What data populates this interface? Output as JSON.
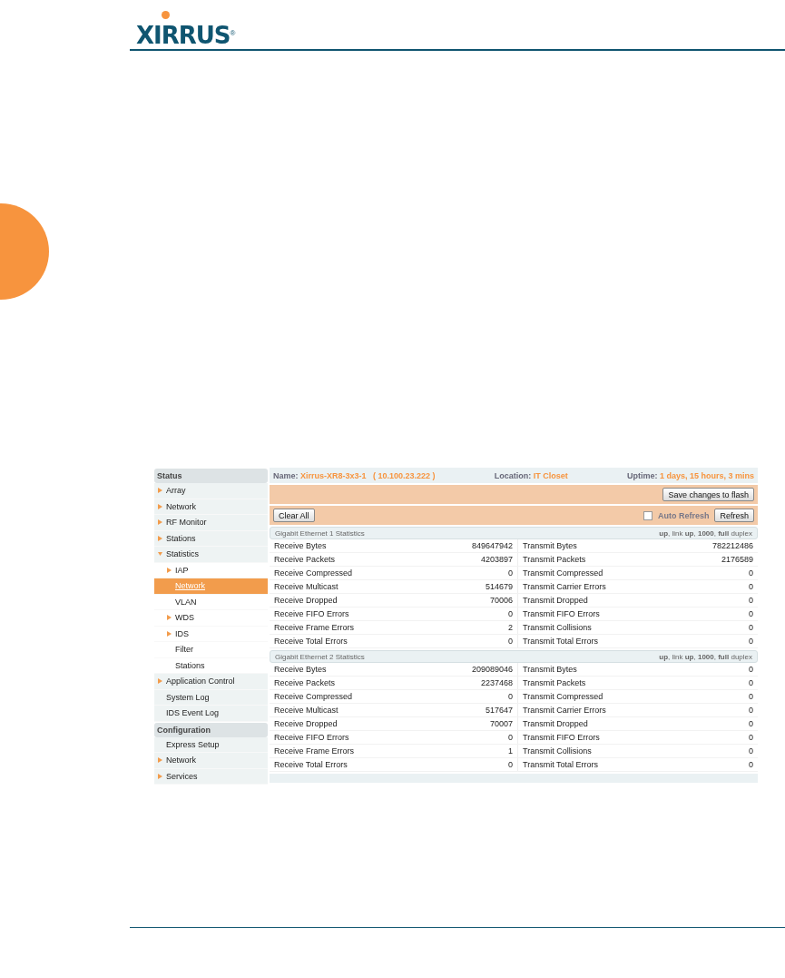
{
  "logo": {
    "text": "XIRRUS",
    "mark": "®"
  },
  "sidebar": {
    "sections": [
      {
        "title": "Status",
        "items": [
          {
            "label": "Array",
            "kind": "group",
            "expanded": false,
            "selected": false
          },
          {
            "label": "Network",
            "kind": "group",
            "expanded": false,
            "selected": false
          },
          {
            "label": "RF Monitor",
            "kind": "group",
            "expanded": false,
            "selected": false
          },
          {
            "label": "Stations",
            "kind": "group",
            "expanded": false,
            "selected": false
          },
          {
            "label": "Statistics",
            "kind": "group",
            "expanded": true,
            "selected": false,
            "children": [
              {
                "label": "IAP",
                "kind": "group",
                "expanded": false,
                "selected": false
              },
              {
                "label": "Network",
                "kind": "link",
                "expanded": false,
                "selected": true
              },
              {
                "label": "VLAN",
                "kind": "link",
                "expanded": false,
                "selected": false
              },
              {
                "label": "WDS",
                "kind": "group",
                "expanded": false,
                "selected": false
              },
              {
                "label": "IDS",
                "kind": "group",
                "expanded": false,
                "selected": false
              },
              {
                "label": "Filter",
                "kind": "link",
                "expanded": false,
                "selected": false
              },
              {
                "label": "Stations",
                "kind": "link",
                "expanded": false,
                "selected": false
              }
            ]
          },
          {
            "label": "Application Control",
            "kind": "group",
            "expanded": false,
            "selected": false
          },
          {
            "label": "System Log",
            "kind": "link",
            "expanded": false,
            "selected": false
          },
          {
            "label": "IDS Event Log",
            "kind": "link",
            "expanded": false,
            "selected": false
          }
        ]
      },
      {
        "title": "Configuration",
        "items": [
          {
            "label": "Express Setup",
            "kind": "link",
            "expanded": false,
            "selected": false
          },
          {
            "label": "Network",
            "kind": "group",
            "expanded": false,
            "selected": false
          },
          {
            "label": "Services",
            "kind": "group",
            "expanded": false,
            "selected": false
          }
        ]
      }
    ]
  },
  "header": {
    "name_label": "Name:",
    "name": "Xirrus-XR8-3x3-1   ( 10.100.23.222 )",
    "location_label": "Location:",
    "location": "IT Closet",
    "uptime_label": "Uptime:",
    "uptime": "1 days, 15 hours, 3 mins"
  },
  "save_button": "Save changes to flash",
  "toolbar": {
    "clear_button": "Clear All",
    "auto_refresh": {
      "label": "Auto Refresh",
      "checked": false
    },
    "refresh_button": "Refresh"
  },
  "interfaces": [
    {
      "title": "Gigabit Ethernet 1 Statistics",
      "status": "**up**, link **up**, **1000**, **full** duplex",
      "rows": [
        [
          "Receive Bytes",
          "849647942",
          "Transmit Bytes",
          "782212486"
        ],
        [
          "Receive Packets",
          "4203897",
          "Transmit Packets",
          "2176589"
        ],
        [
          "Receive Compressed",
          "0",
          "Transmit Compressed",
          "0"
        ],
        [
          "Receive Multicast",
          "514679",
          "Transmit Carrier Errors",
          "0"
        ],
        [
          "Receive Dropped",
          "70006",
          "Transmit Dropped",
          "0"
        ],
        [
          "Receive FIFO Errors",
          "0",
          "Transmit FIFO Errors",
          "0"
        ],
        [
          "Receive Frame Errors",
          "2",
          "Transmit Collisions",
          "0"
        ],
        [
          "Receive Total Errors",
          "0",
          "Transmit Total Errors",
          "0"
        ]
      ]
    },
    {
      "title": "Gigabit Ethernet 2 Statistics",
      "status": "**up**, link **up**, **1000**, **full** duplex",
      "rows": [
        [
          "Receive Bytes",
          "209089046",
          "Transmit Bytes",
          "0"
        ],
        [
          "Receive Packets",
          "2237468",
          "Transmit Packets",
          "0"
        ],
        [
          "Receive Compressed",
          "0",
          "Transmit Compressed",
          "0"
        ],
        [
          "Receive Multicast",
          "517647",
          "Transmit Carrier Errors",
          "0"
        ],
        [
          "Receive Dropped",
          "70007",
          "Transmit Dropped",
          "0"
        ],
        [
          "Receive FIFO Errors",
          "0",
          "Transmit FIFO Errors",
          "0"
        ],
        [
          "Receive Frame Errors",
          "1",
          "Transmit Collisions",
          "0"
        ],
        [
          "Receive Total Errors",
          "0",
          "Transmit Total Errors",
          "0"
        ]
      ]
    }
  ]
}
